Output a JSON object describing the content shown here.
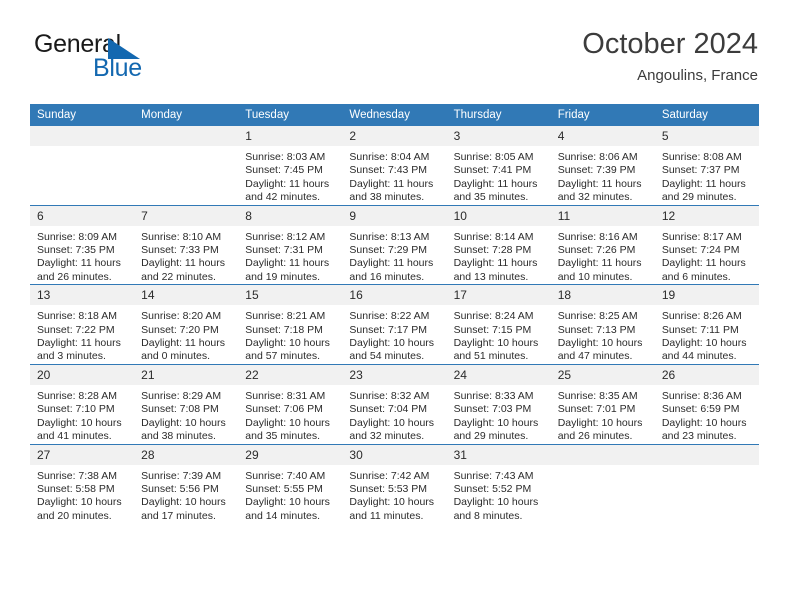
{
  "brand": {
    "name_part1": "General",
    "name_part2": "Blue",
    "triangle_icon": "brand-triangle-icon",
    "color": "#1368b0"
  },
  "header": {
    "title": "October 2024",
    "subtitle": "Angoulins, France"
  },
  "theme": {
    "header_blue": "#3179b6",
    "daynum_band": "#f1f1f1",
    "text": "#2b2b2b"
  },
  "weekdays": [
    "Sunday",
    "Monday",
    "Tuesday",
    "Wednesday",
    "Thursday",
    "Friday",
    "Saturday"
  ],
  "labels": {
    "sunrise": "Sunrise:",
    "sunset": "Sunset:",
    "daylight": "Daylight:"
  },
  "weeks": [
    [
      {
        "day": "",
        "sunrise": "",
        "sunset": "",
        "daylight": ""
      },
      {
        "day": "",
        "sunrise": "",
        "sunset": "",
        "daylight": ""
      },
      {
        "day": "1",
        "sunrise": "Sunrise: 8:03 AM",
        "sunset": "Sunset: 7:45 PM",
        "daylight": "Daylight: 11 hours and 42 minutes."
      },
      {
        "day": "2",
        "sunrise": "Sunrise: 8:04 AM",
        "sunset": "Sunset: 7:43 PM",
        "daylight": "Daylight: 11 hours and 38 minutes."
      },
      {
        "day": "3",
        "sunrise": "Sunrise: 8:05 AM",
        "sunset": "Sunset: 7:41 PM",
        "daylight": "Daylight: 11 hours and 35 minutes."
      },
      {
        "day": "4",
        "sunrise": "Sunrise: 8:06 AM",
        "sunset": "Sunset: 7:39 PM",
        "daylight": "Daylight: 11 hours and 32 minutes."
      },
      {
        "day": "5",
        "sunrise": "Sunrise: 8:08 AM",
        "sunset": "Sunset: 7:37 PM",
        "daylight": "Daylight: 11 hours and 29 minutes."
      }
    ],
    [
      {
        "day": "6",
        "sunrise": "Sunrise: 8:09 AM",
        "sunset": "Sunset: 7:35 PM",
        "daylight": "Daylight: 11 hours and 26 minutes."
      },
      {
        "day": "7",
        "sunrise": "Sunrise: 8:10 AM",
        "sunset": "Sunset: 7:33 PM",
        "daylight": "Daylight: 11 hours and 22 minutes."
      },
      {
        "day": "8",
        "sunrise": "Sunrise: 8:12 AM",
        "sunset": "Sunset: 7:31 PM",
        "daylight": "Daylight: 11 hours and 19 minutes."
      },
      {
        "day": "9",
        "sunrise": "Sunrise: 8:13 AM",
        "sunset": "Sunset: 7:29 PM",
        "daylight": "Daylight: 11 hours and 16 minutes."
      },
      {
        "day": "10",
        "sunrise": "Sunrise: 8:14 AM",
        "sunset": "Sunset: 7:28 PM",
        "daylight": "Daylight: 11 hours and 13 minutes."
      },
      {
        "day": "11",
        "sunrise": "Sunrise: 8:16 AM",
        "sunset": "Sunset: 7:26 PM",
        "daylight": "Daylight: 11 hours and 10 minutes."
      },
      {
        "day": "12",
        "sunrise": "Sunrise: 8:17 AM",
        "sunset": "Sunset: 7:24 PM",
        "daylight": "Daylight: 11 hours and 6 minutes."
      }
    ],
    [
      {
        "day": "13",
        "sunrise": "Sunrise: 8:18 AM",
        "sunset": "Sunset: 7:22 PM",
        "daylight": "Daylight: 11 hours and 3 minutes."
      },
      {
        "day": "14",
        "sunrise": "Sunrise: 8:20 AM",
        "sunset": "Sunset: 7:20 PM",
        "daylight": "Daylight: 11 hours and 0 minutes."
      },
      {
        "day": "15",
        "sunrise": "Sunrise: 8:21 AM",
        "sunset": "Sunset: 7:18 PM",
        "daylight": "Daylight: 10 hours and 57 minutes."
      },
      {
        "day": "16",
        "sunrise": "Sunrise: 8:22 AM",
        "sunset": "Sunset: 7:17 PM",
        "daylight": "Daylight: 10 hours and 54 minutes."
      },
      {
        "day": "17",
        "sunrise": "Sunrise: 8:24 AM",
        "sunset": "Sunset: 7:15 PM",
        "daylight": "Daylight: 10 hours and 51 minutes."
      },
      {
        "day": "18",
        "sunrise": "Sunrise: 8:25 AM",
        "sunset": "Sunset: 7:13 PM",
        "daylight": "Daylight: 10 hours and 47 minutes."
      },
      {
        "day": "19",
        "sunrise": "Sunrise: 8:26 AM",
        "sunset": "Sunset: 7:11 PM",
        "daylight": "Daylight: 10 hours and 44 minutes."
      }
    ],
    [
      {
        "day": "20",
        "sunrise": "Sunrise: 8:28 AM",
        "sunset": "Sunset: 7:10 PM",
        "daylight": "Daylight: 10 hours and 41 minutes."
      },
      {
        "day": "21",
        "sunrise": "Sunrise: 8:29 AM",
        "sunset": "Sunset: 7:08 PM",
        "daylight": "Daylight: 10 hours and 38 minutes."
      },
      {
        "day": "22",
        "sunrise": "Sunrise: 8:31 AM",
        "sunset": "Sunset: 7:06 PM",
        "daylight": "Daylight: 10 hours and 35 minutes."
      },
      {
        "day": "23",
        "sunrise": "Sunrise: 8:32 AM",
        "sunset": "Sunset: 7:04 PM",
        "daylight": "Daylight: 10 hours and 32 minutes."
      },
      {
        "day": "24",
        "sunrise": "Sunrise: 8:33 AM",
        "sunset": "Sunset: 7:03 PM",
        "daylight": "Daylight: 10 hours and 29 minutes."
      },
      {
        "day": "25",
        "sunrise": "Sunrise: 8:35 AM",
        "sunset": "Sunset: 7:01 PM",
        "daylight": "Daylight: 10 hours and 26 minutes."
      },
      {
        "day": "26",
        "sunrise": "Sunrise: 8:36 AM",
        "sunset": "Sunset: 6:59 PM",
        "daylight": "Daylight: 10 hours and 23 minutes."
      }
    ],
    [
      {
        "day": "27",
        "sunrise": "Sunrise: 7:38 AM",
        "sunset": "Sunset: 5:58 PM",
        "daylight": "Daylight: 10 hours and 20 minutes."
      },
      {
        "day": "28",
        "sunrise": "Sunrise: 7:39 AM",
        "sunset": "Sunset: 5:56 PM",
        "daylight": "Daylight: 10 hours and 17 minutes."
      },
      {
        "day": "29",
        "sunrise": "Sunrise: 7:40 AM",
        "sunset": "Sunset: 5:55 PM",
        "daylight": "Daylight: 10 hours and 14 minutes."
      },
      {
        "day": "30",
        "sunrise": "Sunrise: 7:42 AM",
        "sunset": "Sunset: 5:53 PM",
        "daylight": "Daylight: 10 hours and 11 minutes."
      },
      {
        "day": "31",
        "sunrise": "Sunrise: 7:43 AM",
        "sunset": "Sunset: 5:52 PM",
        "daylight": "Daylight: 10 hours and 8 minutes."
      },
      {
        "day": "",
        "sunrise": "",
        "sunset": "",
        "daylight": ""
      },
      {
        "day": "",
        "sunrise": "",
        "sunset": "",
        "daylight": ""
      }
    ]
  ]
}
